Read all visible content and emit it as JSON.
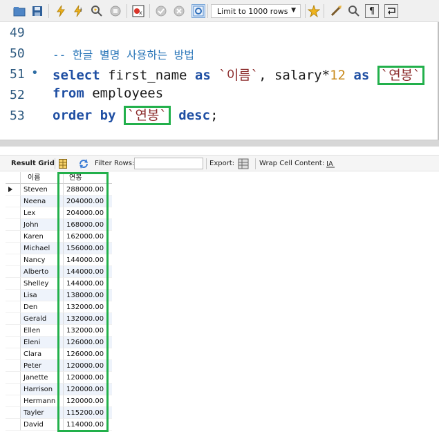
{
  "toolbar": {
    "icons": [
      "open-folder-icon",
      "save-icon",
      "execute-icon",
      "execute-current-icon",
      "explain-icon",
      "stop-icon",
      "toggle-error-icon",
      "commit-icon",
      "rollback-icon",
      "autocommit-icon",
      "beautify-icon",
      "find-icon",
      "invisible-chars-icon",
      "wrap-icon"
    ],
    "limit_label": "Limit to 1000 rows"
  },
  "editor": {
    "lines": [
      {
        "number": "49"
      },
      {
        "number": "50",
        "comment": "-- 한글 별명 사용하는 방법"
      },
      {
        "number": "51",
        "kw1": "select",
        "t1": " first_name ",
        "kw2": "as",
        "t2": " ",
        "str1": "`이름`",
        "t3": ", salary*",
        "num1": "12",
        "t4": " ",
        "kw3": "as",
        "t5": " ",
        "str2": "`연봉`"
      },
      {
        "number": "52",
        "kw1": "from",
        "t1": " employees"
      },
      {
        "number": "53",
        "kw1": "order",
        "t1": " ",
        "kw2": "by",
        "t2": " ",
        "str1": "`연봉`",
        "t3": " ",
        "kw3": "desc",
        "t4": ";"
      }
    ]
  },
  "result_toolbar": {
    "result_grid_label": "Result Grid",
    "filter_rows_label": "Filter Rows:",
    "filter_value": "",
    "export_label": "Export:",
    "wrap_label": "Wrap Cell Content:"
  },
  "grid": {
    "columns": [
      "이름",
      "연봉"
    ],
    "rows": [
      [
        "Steven",
        "288000.00"
      ],
      [
        "Neena",
        "204000.00"
      ],
      [
        "Lex",
        "204000.00"
      ],
      [
        "John",
        "168000.00"
      ],
      [
        "Karen",
        "162000.00"
      ],
      [
        "Michael",
        "156000.00"
      ],
      [
        "Nancy",
        "144000.00"
      ],
      [
        "Alberto",
        "144000.00"
      ],
      [
        "Shelley",
        "144000.00"
      ],
      [
        "Lisa",
        "138000.00"
      ],
      [
        "Den",
        "132000.00"
      ],
      [
        "Gerald",
        "132000.00"
      ],
      [
        "Ellen",
        "132000.00"
      ],
      [
        "Eleni",
        "126000.00"
      ],
      [
        "Clara",
        "126000.00"
      ],
      [
        "Peter",
        "120000.00"
      ],
      [
        "Janette",
        "120000.00"
      ],
      [
        "Harrison",
        "120000.00"
      ],
      [
        "Hermann",
        "120000.00"
      ],
      [
        "Tayler",
        "115200.00"
      ],
      [
        "David",
        "114000.00"
      ]
    ]
  },
  "colors": {
    "highlight": "#22b04b",
    "keyword": "#1f4fa3",
    "string": "#8b2b2b",
    "number": "#c98a1d",
    "comment": "#2a76b8"
  }
}
